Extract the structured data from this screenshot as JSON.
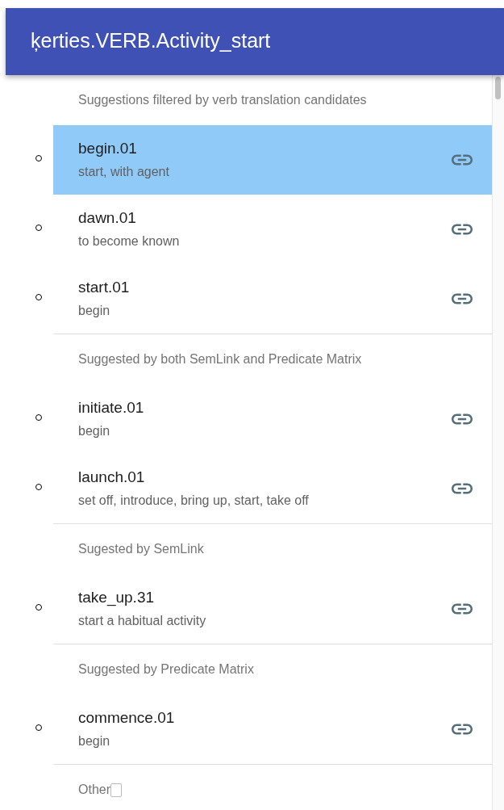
{
  "title": "ķerties.VERB.Activity_start",
  "groups": [
    {
      "heading": "Suggestions filtered by verb translation candidates",
      "items": [
        {
          "name": "begin.01",
          "description": "start, with agent",
          "selected": true
        },
        {
          "name": "dawn.01",
          "description": "to become known",
          "selected": false
        },
        {
          "name": "start.01",
          "description": "begin",
          "selected": false
        }
      ]
    },
    {
      "heading": "Suggested by both SemLink and Predicate Matrix",
      "items": [
        {
          "name": "initiate.01",
          "description": "begin",
          "selected": false
        },
        {
          "name": "launch.01",
          "description": "set off, introduce, bring up, start, take off",
          "selected": false
        }
      ]
    },
    {
      "heading": "Sugested by SemLink",
      "items": [
        {
          "name": "take_up.31",
          "description": "start a habitual activity",
          "selected": false
        }
      ]
    },
    {
      "heading": "Suggested by Predicate Matrix",
      "items": [
        {
          "name": "commence.01",
          "description": "begin",
          "selected": false
        }
      ]
    },
    {
      "heading": "Other"
    }
  ]
}
